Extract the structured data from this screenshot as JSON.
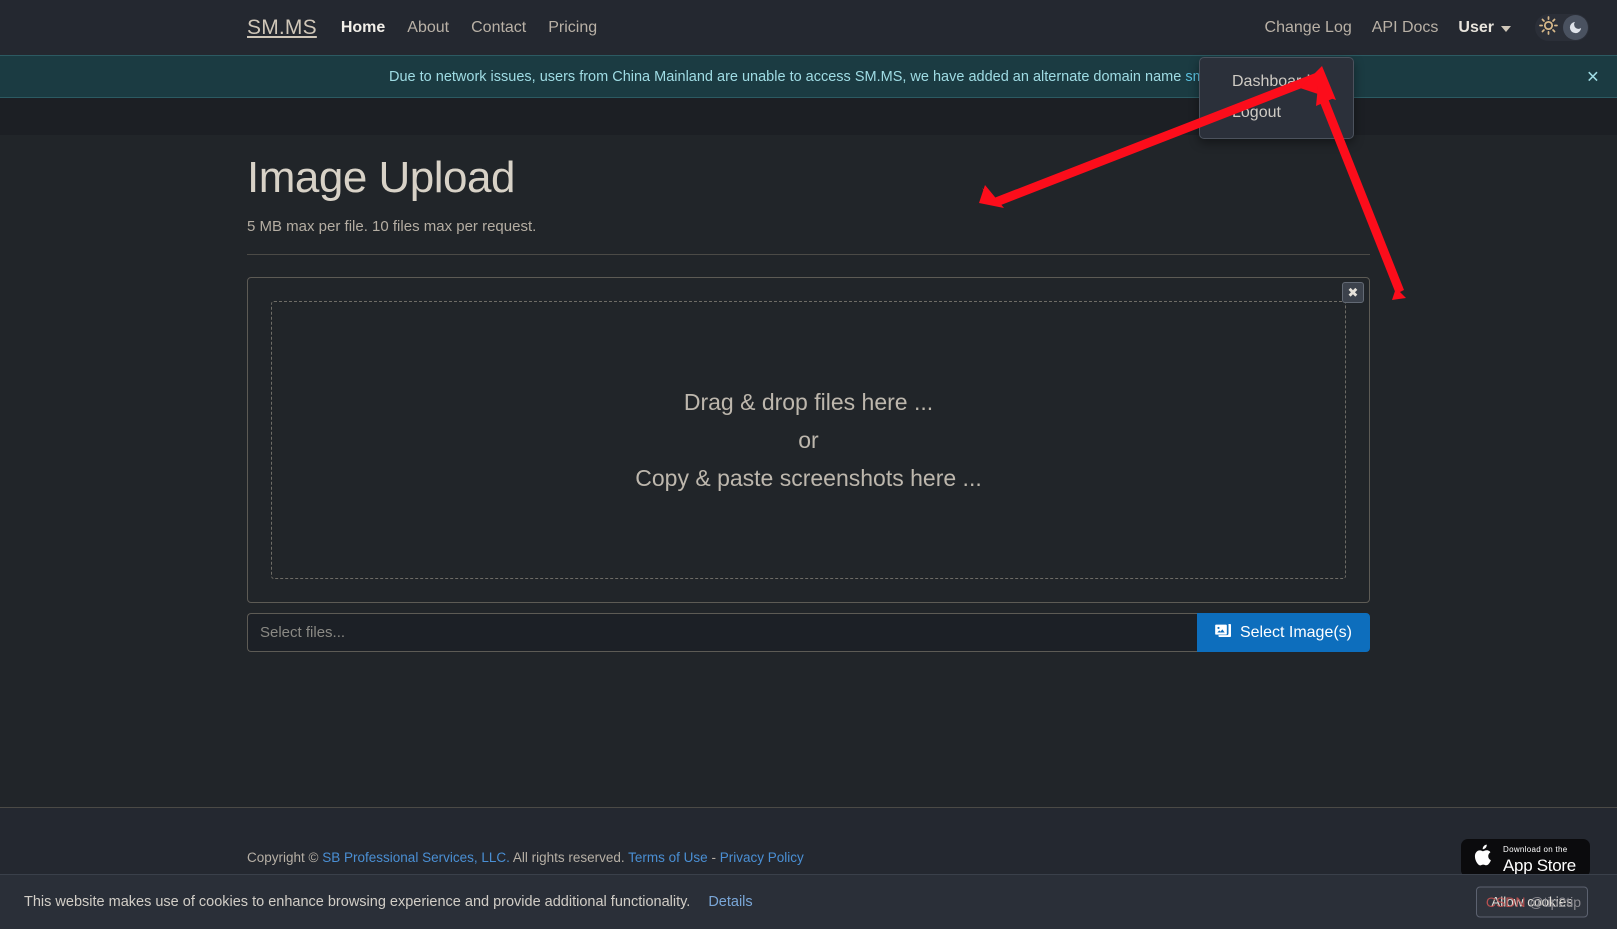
{
  "navbar": {
    "brand": "SM.MS",
    "left_items": [
      {
        "label": "Home",
        "active": true
      },
      {
        "label": "About",
        "active": false
      },
      {
        "label": "Contact",
        "active": false
      },
      {
        "label": "Pricing",
        "active": false
      }
    ],
    "right_items": [
      {
        "label": "Change Log"
      },
      {
        "label": "API Docs"
      }
    ],
    "user_label": "User",
    "theme_toggle": {
      "light_icon": "sun-icon",
      "dark_icon": "moon-icon",
      "active": "dark"
    }
  },
  "dropdown": {
    "items": [
      {
        "label": "Dashboard"
      },
      {
        "label": "Logout"
      }
    ]
  },
  "alert": {
    "message": "Due to network issues, users from China Mainland are unable to access SM.MS, we have added an alternate domain name ",
    "link": "smms.",
    "close_icon": "close-icon"
  },
  "main": {
    "title": "Image Upload",
    "subtitle": "5 MB max per file. 10 files max per request.",
    "panel_close_icon": "close-icon",
    "dropzone": {
      "line1": "Drag & drop files here ...",
      "line2": "or",
      "line3": "Copy & paste screenshots here ..."
    },
    "file_field_placeholder": "Select files...",
    "file_field_value": "",
    "select_button_label": "Select Image(s)",
    "select_button_icon": "image-icon",
    "accent_color": "#0d6ebd"
  },
  "footer": {
    "copyright_prefix": "Copyright",
    "copyright_symbol": "©",
    "company": "SB Professional Services, LLC.",
    "rights": " All rights reserved. ",
    "terms": "Terms of Use",
    "separator": " - ",
    "privacy": "Privacy Policy",
    "appstore": {
      "small": "Download on the",
      "big": "App Store",
      "icon": "apple-icon"
    }
  },
  "cookiebar": {
    "message": "This website makes use of cookies to enhance browsing experience and provide additional functionality.",
    "details_label": "Details",
    "button_label": "Allow cookies"
  },
  "watermark": {
    "prefix": "CSDN ",
    "handle": "@tip2tip"
  }
}
